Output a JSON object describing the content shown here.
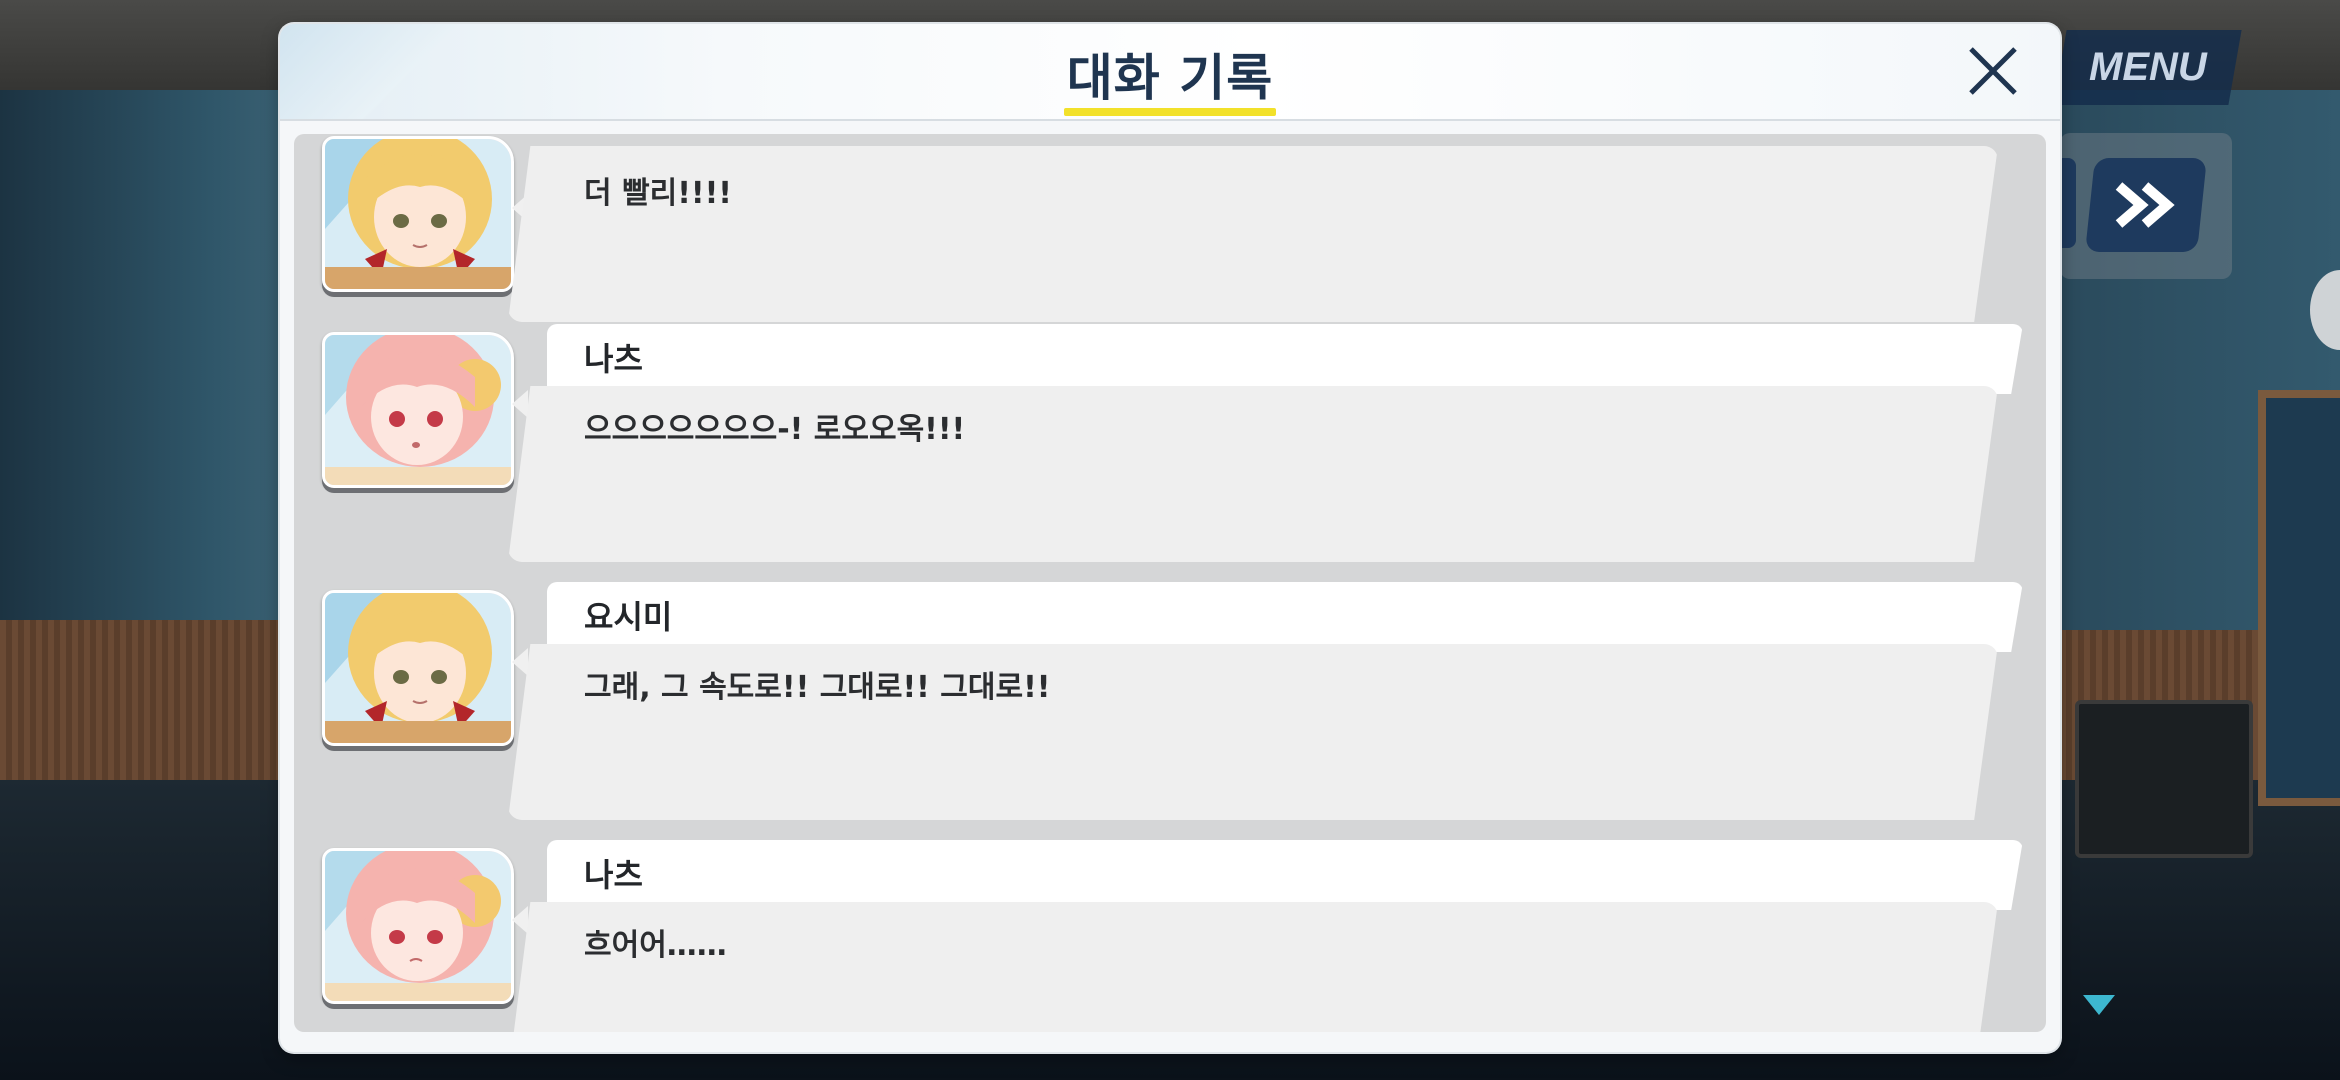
{
  "header": {
    "title": "대화 기록"
  },
  "menu": {
    "label": "MENU"
  },
  "entries": [
    {
      "speaker": "",
      "text": "더 빨리!!!!",
      "character": "yoshimi"
    },
    {
      "speaker": "나츠",
      "text": "으으으으으으으-! 로오오옥!!!",
      "character": "natsu"
    },
    {
      "speaker": "요시미",
      "text": "그래, 그 속도로!! 그대로!! 그대로!!",
      "character": "yoshimi"
    },
    {
      "speaker": "나츠",
      "text": "흐어어……",
      "character": "natsu"
    }
  ],
  "icons": {
    "close": "close-icon",
    "fast_forward": "fast-forward-icon",
    "scroll_down": "triangle-down-icon"
  },
  "colors": {
    "title": "#1f3550",
    "title_underline": "#f2e12a",
    "menu_bg": "#142d4b",
    "menu_text": "#c9d6e6",
    "scroll_arrow": "#3db7cf"
  }
}
